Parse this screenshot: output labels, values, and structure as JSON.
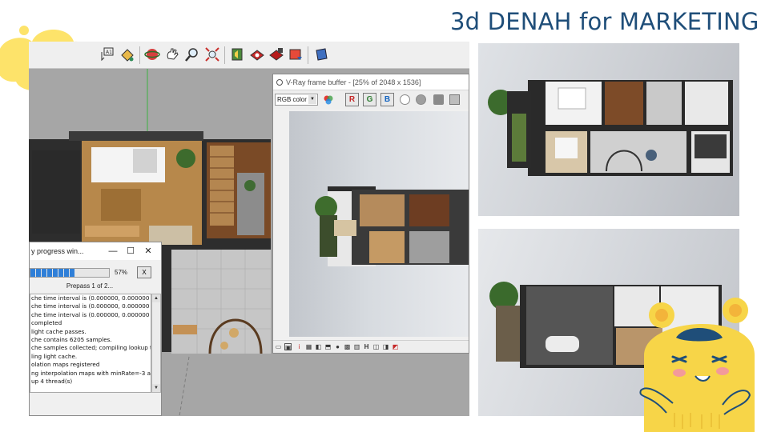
{
  "slide": {
    "title": "3d DENAH for MARKETING"
  },
  "sketchup": {
    "toolbar_icons": [
      "text-tool-icon",
      "paint-bucket-icon",
      "orbit-icon",
      "pan-icon",
      "zoom-icon",
      "zoom-extents-icon",
      "previous-view-icon",
      "vray-render-icon",
      "vray-interactive-icon",
      "vray-frame-buffer-icon",
      "export-icon",
      "component-icon"
    ]
  },
  "vfb": {
    "title": "V-Ray frame buffer - [25% of 2048 x 1536]",
    "channel": "RGB color",
    "buttons": {
      "r": "R",
      "g": "G",
      "b": "B"
    }
  },
  "progress": {
    "title": "y progress win...",
    "minimize": "—",
    "maximize": "☐",
    "close": "✕",
    "percent": "57%",
    "percent_value": 0.57,
    "cancel": "X",
    "pass": "Prepass 1 of 2...",
    "log": [
      "che time interval is (0.000000, 0.000000",
      "che time interval is (0.000000, 0.000000",
      "che time interval is (0.000000, 0.000000",
      " completed",
      " light cache passes.",
      "che contains 6205 samples.",
      "che samples collected; compiling lookup t",
      "ling light cache.",
      "olation maps registered",
      "ng interpolation maps with minRate=-3 a",
      "up 4 thread(s)"
    ]
  },
  "colors": {
    "title": "#1f4e79",
    "accent_yellow": "#fde36a",
    "progress_blue": "#2f7fd8"
  }
}
